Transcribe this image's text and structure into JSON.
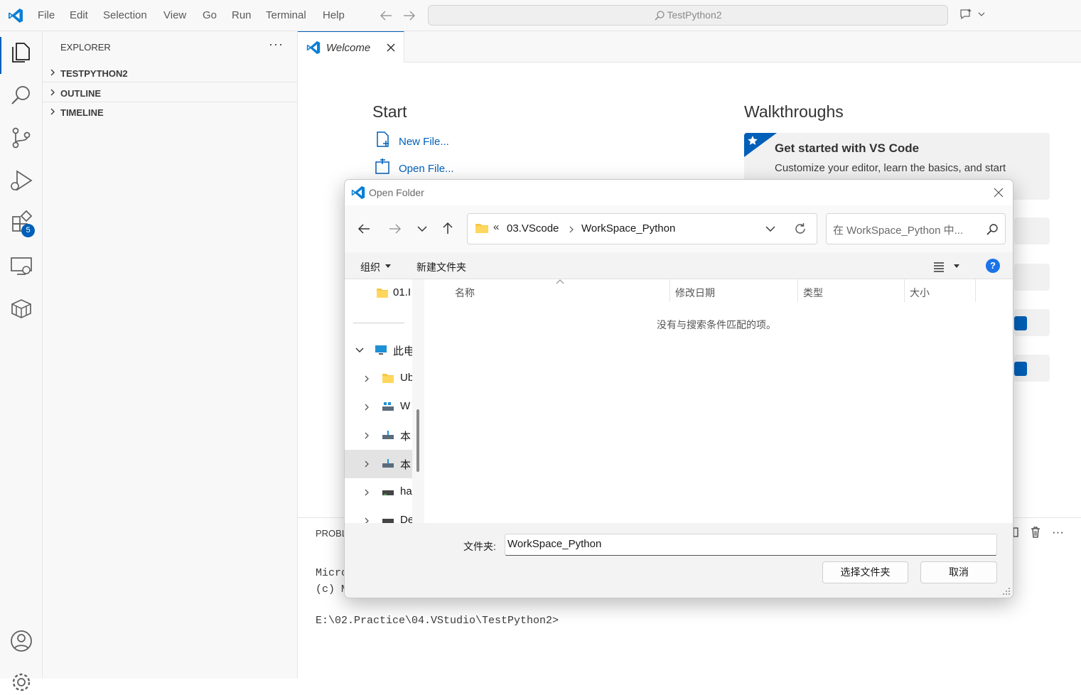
{
  "titlebar": {
    "menu": [
      "File",
      "Edit",
      "Selection",
      "View",
      "Go",
      "Run",
      "Terminal",
      "Help"
    ],
    "command_center": "TestPython2"
  },
  "activity_bar": {
    "extensions_badge": "5"
  },
  "sidebar": {
    "title": "EXPLORER",
    "more": "···",
    "sections": [
      "TESTPYTHON2",
      "OUTLINE",
      "TIMELINE"
    ]
  },
  "editor": {
    "tab_label": "Welcome",
    "start_heading": "Start",
    "new_file": "New File...",
    "open_file": "Open File...",
    "walkthroughs_heading": "Walkthroughs",
    "walkthrough_title": "Get started with VS Code",
    "walkthrough_desc": "Customize your editor, learn the basics, and start"
  },
  "panel": {
    "tab_label": "PROBL",
    "line1": "Micro",
    "line2": "(c) M",
    "prompt": "E:\\02.Practice\\04.VStudio\\TestPython2>"
  },
  "dialog": {
    "title": "Open Folder",
    "breadcrumb_overflow": "«",
    "breadcrumb": [
      "03.VScode",
      "WorkSpace_Python"
    ],
    "search_placeholder": "在 WorkSpace_Python 中...",
    "toolbar": {
      "organize": "组织",
      "new_folder": "新建文件夹"
    },
    "tree": [
      {
        "label": "01.I",
        "icon": "folder-icon"
      },
      {
        "label": "此电",
        "icon": "this-pc-icon"
      },
      {
        "label": "Ub",
        "icon": "folder-icon"
      },
      {
        "label": "W",
        "icon": "network-drive-icon"
      },
      {
        "label": "本",
        "icon": "network-drive-icon"
      },
      {
        "label": "本",
        "icon": "network-drive-icon"
      },
      {
        "label": "ha",
        "icon": "drive-icon"
      },
      {
        "label": "De",
        "icon": "drive-icon"
      }
    ],
    "columns": [
      "名称",
      "修改日期",
      "类型",
      "大小"
    ],
    "empty_message": "没有与搜索条件匹配的项。",
    "folder_label": "文件夹:",
    "folder_value": "WorkSpace_Python",
    "select_button": "选择文件夹",
    "cancel_button": "取消"
  }
}
